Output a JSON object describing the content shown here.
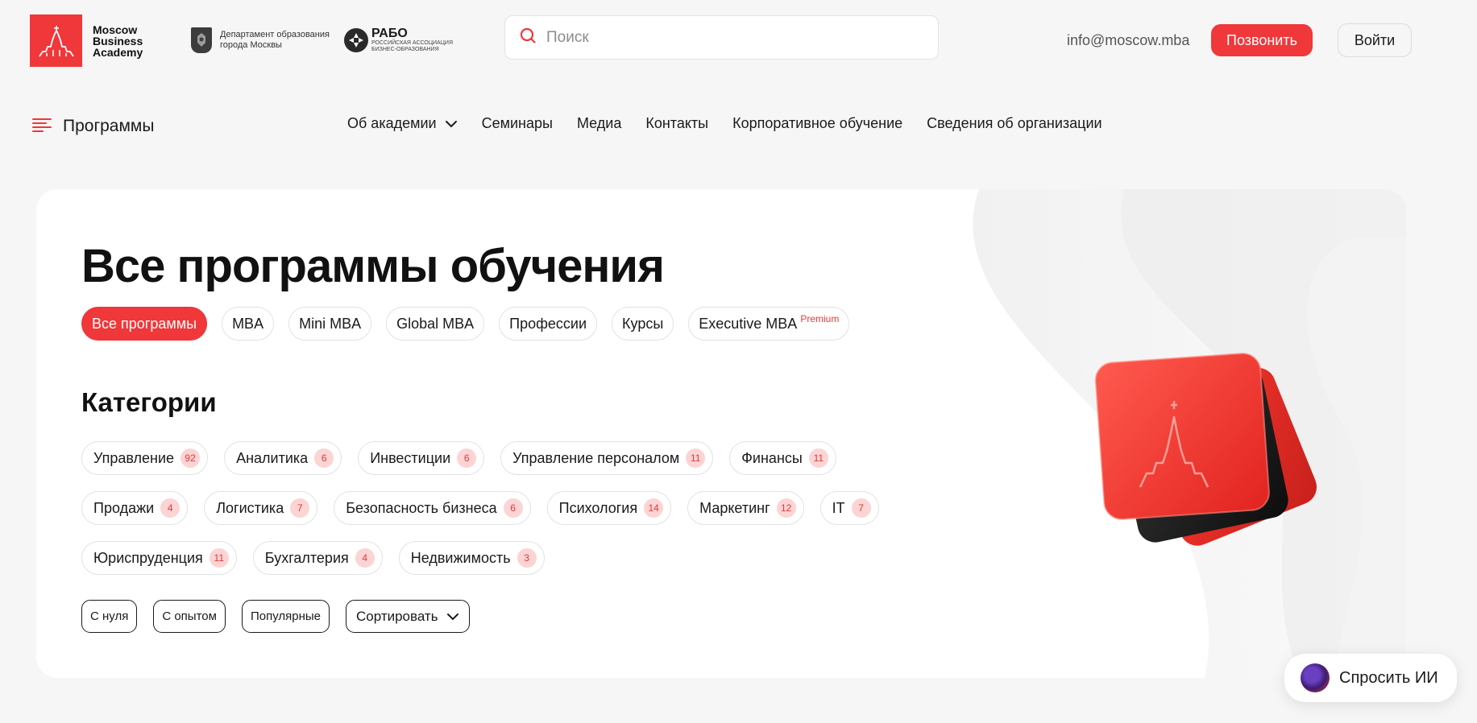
{
  "brand": {
    "logo_lines": [
      "Moscow",
      "Business",
      "Academy"
    ],
    "dept_lines": [
      "Департамент образования",
      "города Москвы"
    ],
    "rabo_title": "РАБО",
    "rabo_sub_lines": [
      "РОССИЙСКАЯ АССОЦИАЦИЯ",
      "БИЗНЕС-ОБРАЗОВАНИЯ"
    ]
  },
  "search": {
    "placeholder": "Поиск"
  },
  "header": {
    "email": "info@moscow.mba",
    "call_label": "Позвонить",
    "login_label": "Войти"
  },
  "nav": {
    "programs_label": "Программы",
    "items": [
      "Об академии",
      "Семинары",
      "Медиа",
      "Контакты",
      "Корпоративное обучение",
      "Сведения об организации"
    ]
  },
  "main": {
    "title": "Все программы обучения",
    "program_tabs": [
      "Все программы",
      "MBA",
      "Mini MBA",
      "Global MBA",
      "Профессии",
      "Курсы",
      "Executive MBA"
    ],
    "premium_label": "Premium",
    "categories_title": "Категории",
    "categories": [
      {
        "label": "Управление",
        "count": "92"
      },
      {
        "label": "Аналитика",
        "count": "6"
      },
      {
        "label": "Инвестиции",
        "count": "6"
      },
      {
        "label": "Управление персоналом",
        "count": "11"
      },
      {
        "label": "Финансы",
        "count": "11"
      },
      {
        "label": "Продажи",
        "count": "4"
      },
      {
        "label": "Логистика",
        "count": "7"
      },
      {
        "label": "Безопасность бизнеса",
        "count": "6"
      },
      {
        "label": "Психология",
        "count": "14"
      },
      {
        "label": "Маркетинг",
        "count": "12"
      },
      {
        "label": "IT",
        "count": "7"
      },
      {
        "label": "Юриспруденция",
        "count": "11"
      },
      {
        "label": "Бухгалтерия",
        "count": "4"
      },
      {
        "label": "Недвижимость",
        "count": "3"
      }
    ],
    "filters": [
      "С нуля",
      "С опытом",
      "Популярные"
    ],
    "sort_label": "Сортировать"
  },
  "ask_ai": {
    "label": "Спросить ИИ"
  },
  "colors": {
    "accent": "#f0373a",
    "badge_bg": "#fcd4d4",
    "page_bg": "#f6f6f6"
  }
}
